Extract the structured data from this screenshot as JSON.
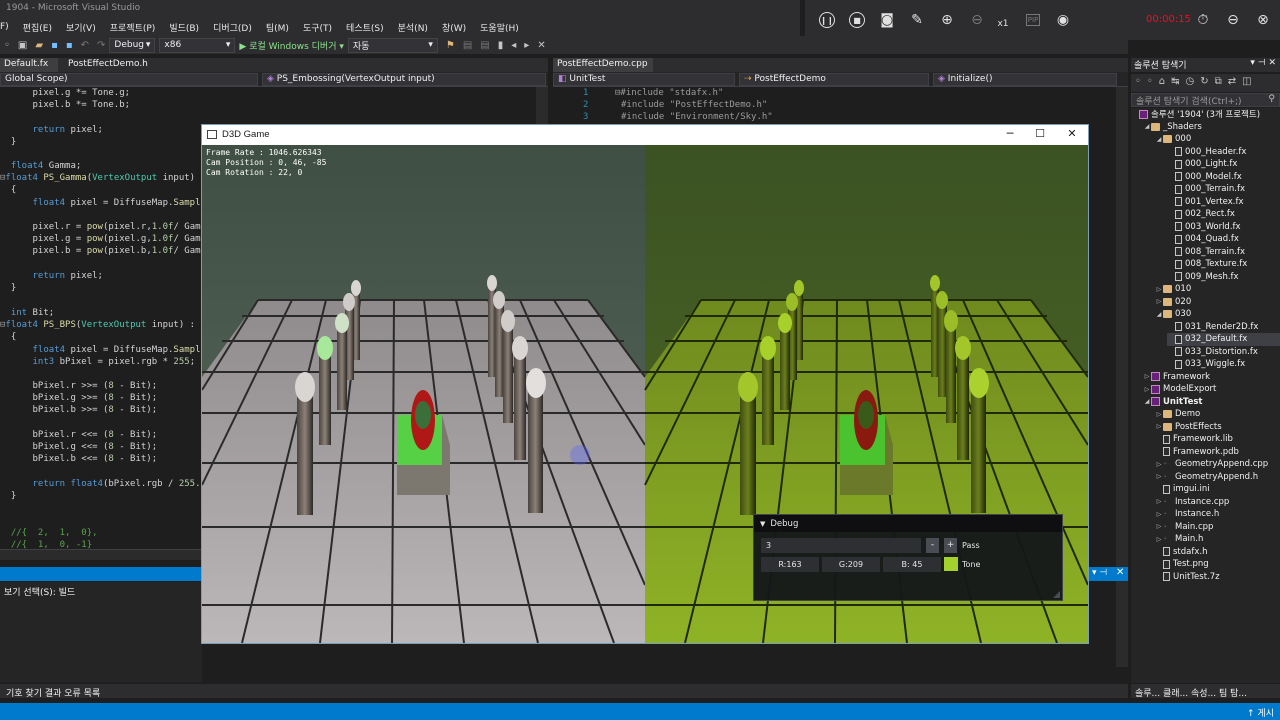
{
  "window": {
    "title": "1904 - Microsoft Visual Studio",
    "menu": [
      "F)",
      "편집(E)",
      "보기(V)",
      "프로젝트(P)",
      "빌드(B)",
      "디버그(D)",
      "팀(M)",
      "도구(T)",
      "테스트(S)",
      "분석(N)",
      "창(W)",
      "도움말(H)"
    ]
  },
  "recorder": {
    "time": "00:00:15",
    "zoom": "x1"
  },
  "toolbar": {
    "config": "Debug",
    "platform": "x86",
    "run_label": "▶ 로컬 Windows 디버거 ▾",
    "auto": "자동"
  },
  "left_editor": {
    "tabs": [
      "Default.fx",
      "PostEffectDemo.h"
    ],
    "scope": "Global Scope)",
    "function_dd": "PS_Embossing(VertexOutput input)"
  },
  "right_editor": {
    "tabs": [
      "PostEffectDemo.cpp"
    ],
    "project_dd": "UnitTest",
    "class_dd": "PostEffectDemo",
    "method_dd": "Initialize()",
    "code_lines": [
      {
        "n": "1",
        "text": "#include \"stdafx.h\""
      },
      {
        "n": "2",
        "text": "#include \"PostEffectDemo.h\""
      },
      {
        "n": "3",
        "text": "#include \"Environment/Sky.h\""
      }
    ]
  },
  "output": {
    "label": "보기 선택(S):  빌드"
  },
  "bottom_tabs": {
    "left": "기호 찾기 결과   오류 목록",
    "right": "솔루...  클래...  속성...  팀 탐..."
  },
  "status": {
    "right": "↑ 게시"
  },
  "solution": {
    "title": "솔루션 탐색기",
    "search_placeholder": "솔루션 탐색기 검색(Ctrl+;)",
    "items": [
      {
        "label": "솔루션 '1904' (3개 프로젝트)",
        "level": 0,
        "type": "proj",
        "exp": ""
      },
      {
        "label": "_Shaders",
        "level": 1,
        "type": "folder",
        "exp": "◢"
      },
      {
        "label": "000",
        "level": 2,
        "type": "folder",
        "exp": "◢"
      },
      {
        "label": "000_Header.fx",
        "level": 3,
        "type": "file",
        "exp": ""
      },
      {
        "label": "000_Light.fx",
        "level": 3,
        "type": "file",
        "exp": ""
      },
      {
        "label": "000_Model.fx",
        "level": 3,
        "type": "file",
        "exp": ""
      },
      {
        "label": "000_Terrain.fx",
        "level": 3,
        "type": "file",
        "exp": ""
      },
      {
        "label": "001_Vertex.fx",
        "level": 3,
        "type": "file",
        "exp": ""
      },
      {
        "label": "002_Rect.fx",
        "level": 3,
        "type": "file",
        "exp": ""
      },
      {
        "label": "003_World.fx",
        "level": 3,
        "type": "file",
        "exp": ""
      },
      {
        "label": "004_Quad.fx",
        "level": 3,
        "type": "file",
        "exp": ""
      },
      {
        "label": "008_Terrain.fx",
        "level": 3,
        "type": "file",
        "exp": ""
      },
      {
        "label": "008_Texture.fx",
        "level": 3,
        "type": "file",
        "exp": ""
      },
      {
        "label": "009_Mesh.fx",
        "level": 3,
        "type": "file",
        "exp": ""
      },
      {
        "label": "010",
        "level": 2,
        "type": "folder",
        "exp": "▷"
      },
      {
        "label": "020",
        "level": 2,
        "type": "folder",
        "exp": "▷"
      },
      {
        "label": "030",
        "level": 2,
        "type": "folder",
        "exp": "◢"
      },
      {
        "label": "031_Render2D.fx",
        "level": 3,
        "type": "file",
        "exp": ""
      },
      {
        "label": "032_Default.fx",
        "level": 3,
        "type": "file",
        "exp": "",
        "selected": true
      },
      {
        "label": "033_Distortion.fx",
        "level": 3,
        "type": "file",
        "exp": ""
      },
      {
        "label": "033_Wiggle.fx",
        "level": 3,
        "type": "file",
        "exp": ""
      },
      {
        "label": "Framework",
        "level": 1,
        "type": "proj",
        "exp": "▷"
      },
      {
        "label": "ModelExport",
        "level": 1,
        "type": "proj",
        "exp": "▷"
      },
      {
        "label": "UnitTest",
        "level": 1,
        "type": "proj",
        "exp": "◢",
        "bold": true
      },
      {
        "label": "Demo",
        "level": 2,
        "type": "folder",
        "exp": "▷"
      },
      {
        "label": "PostEffects",
        "level": 2,
        "type": "folder",
        "exp": "▷"
      },
      {
        "label": "Framework.lib",
        "level": 2,
        "type": "file",
        "exp": ""
      },
      {
        "label": "Framework.pdb",
        "level": 2,
        "type": "file",
        "exp": ""
      },
      {
        "label": "GeometryAppend.cpp",
        "level": 2,
        "type": "cpp",
        "exp": "▷"
      },
      {
        "label": "GeometryAppend.h",
        "level": 2,
        "type": "cpp",
        "exp": "▷"
      },
      {
        "label": "imgui.ini",
        "level": 2,
        "type": "file",
        "exp": ""
      },
      {
        "label": "Instance.cpp",
        "level": 2,
        "type": "cpp",
        "exp": "▷"
      },
      {
        "label": "Instance.h",
        "level": 2,
        "type": "cpp",
        "exp": "▷"
      },
      {
        "label": "Main.cpp",
        "level": 2,
        "type": "cpp",
        "exp": "▷"
      },
      {
        "label": "Main.h",
        "level": 2,
        "type": "cpp",
        "exp": "▷"
      },
      {
        "label": "stdafx.h",
        "level": 2,
        "type": "file",
        "exp": ""
      },
      {
        "label": "Test.png",
        "level": 2,
        "type": "file",
        "exp": ""
      },
      {
        "label": "UnitTest.7z",
        "level": 2,
        "type": "file",
        "exp": ""
      }
    ]
  },
  "game": {
    "title": "D3D Game",
    "overlay": [
      "Frame Rate : 1046.626343",
      "Cam Position : 0, 46, -85",
      "Cam Rotation : 22, 0"
    ]
  },
  "debug_panel": {
    "title": "Debug",
    "pass_value": "3",
    "minus": "-",
    "plus": "+",
    "pass_label": "Pass",
    "r": "R:163",
    "g": "G:209",
    "b": "B: 45",
    "tone_label": "Tone",
    "tone_color": "#a3d12d"
  }
}
